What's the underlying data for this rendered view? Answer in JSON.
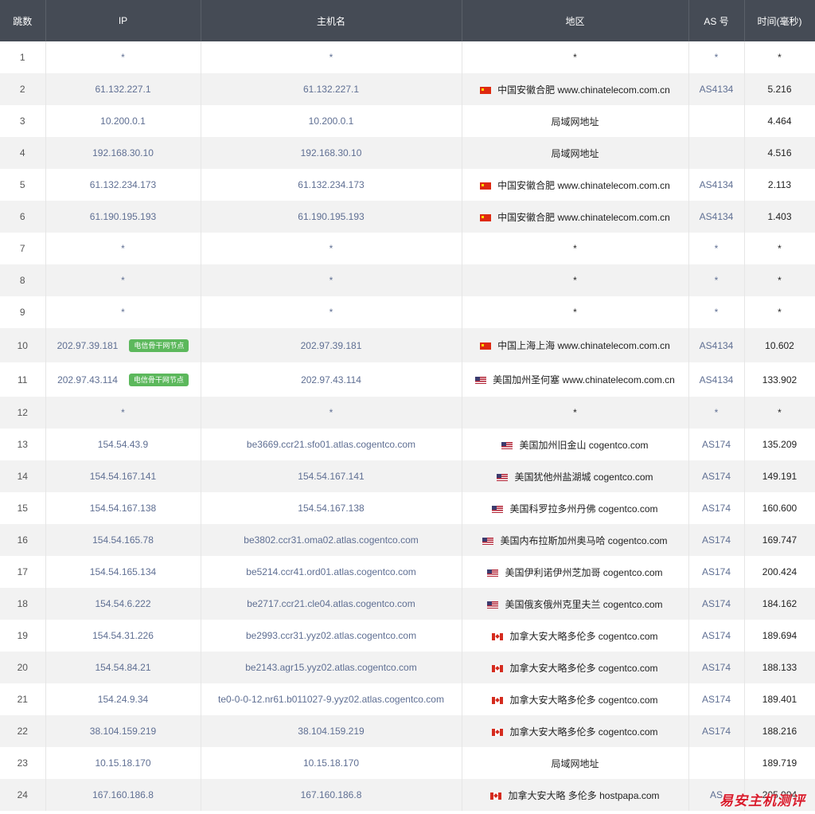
{
  "headers": {
    "hop": "跳数",
    "ip": "IP",
    "host": "主机名",
    "region": "地区",
    "as": "AS 号",
    "time": "时间(毫秒)"
  },
  "colors": {
    "header_bg": "#454b55",
    "badge_bg": "#5cb85c",
    "link_text": "#5f6f93",
    "stripe": "#f2f2f2",
    "watermark": "#d91c2c"
  },
  "rows": [
    {
      "hop": "1",
      "ip": "*",
      "host": "*",
      "flag": "",
      "region": "*",
      "as": "*",
      "time": "*"
    },
    {
      "hop": "2",
      "ip": "61.132.227.1",
      "host": "61.132.227.1",
      "flag": "cn-flag-icon",
      "region": "中国安徽合肥 www.chinatelecom.com.cn",
      "as": "AS4134",
      "time": "5.216"
    },
    {
      "hop": "3",
      "ip": "10.200.0.1",
      "host": "10.200.0.1",
      "flag": "",
      "region": "局域网地址",
      "as": "",
      "time": "4.464"
    },
    {
      "hop": "4",
      "ip": "192.168.30.10",
      "host": "192.168.30.10",
      "flag": "",
      "region": "局域网地址",
      "as": "",
      "time": "4.516"
    },
    {
      "hop": "5",
      "ip": "61.132.234.173",
      "host": "61.132.234.173",
      "flag": "cn-flag-icon",
      "region": "中国安徽合肥 www.chinatelecom.com.cn",
      "as": "AS4134",
      "time": "2.113"
    },
    {
      "hop": "6",
      "ip": "61.190.195.193",
      "host": "61.190.195.193",
      "flag": "cn-flag-icon",
      "region": "中国安徽合肥 www.chinatelecom.com.cn",
      "as": "AS4134",
      "time": "1.403"
    },
    {
      "hop": "7",
      "ip": "*",
      "host": "*",
      "flag": "",
      "region": "*",
      "as": "*",
      "time": "*"
    },
    {
      "hop": "8",
      "ip": "*",
      "host": "*",
      "flag": "",
      "region": "*",
      "as": "*",
      "time": "*"
    },
    {
      "hop": "9",
      "ip": "*",
      "host": "*",
      "flag": "",
      "region": "*",
      "as": "*",
      "time": "*"
    },
    {
      "hop": "10",
      "ip": "202.97.39.181",
      "badge": "电信骨干网节点",
      "host": "202.97.39.181",
      "flag": "cn-flag-icon",
      "region": "中国上海上海 www.chinatelecom.com.cn",
      "as": "AS4134",
      "time": "10.602"
    },
    {
      "hop": "11",
      "ip": "202.97.43.114",
      "badge": "电信骨干网节点",
      "host": "202.97.43.114",
      "flag": "us-flag-icon",
      "region": "美国加州圣何塞 www.chinatelecom.com.cn",
      "as": "AS4134",
      "time": "133.902"
    },
    {
      "hop": "12",
      "ip": "*",
      "host": "*",
      "flag": "",
      "region": "*",
      "as": "*",
      "time": "*"
    },
    {
      "hop": "13",
      "ip": "154.54.43.9",
      "host": "be3669.ccr21.sfo01.atlas.cogentco.com",
      "flag": "us-flag-icon",
      "region": "美国加州旧金山 cogentco.com",
      "as": "AS174",
      "time": "135.209"
    },
    {
      "hop": "14",
      "ip": "154.54.167.141",
      "host": "154.54.167.141",
      "flag": "us-flag-icon",
      "region": "美国犹他州盐湖城 cogentco.com",
      "as": "AS174",
      "time": "149.191"
    },
    {
      "hop": "15",
      "ip": "154.54.167.138",
      "host": "154.54.167.138",
      "flag": "us-flag-icon",
      "region": "美国科罗拉多州丹佛 cogentco.com",
      "as": "AS174",
      "time": "160.600"
    },
    {
      "hop": "16",
      "ip": "154.54.165.78",
      "host": "be3802.ccr31.oma02.atlas.cogentco.com",
      "flag": "us-flag-icon",
      "region": "美国内布拉斯加州奥马哈 cogentco.com",
      "as": "AS174",
      "time": "169.747"
    },
    {
      "hop": "17",
      "ip": "154.54.165.134",
      "host": "be5214.ccr41.ord01.atlas.cogentco.com",
      "flag": "us-flag-icon",
      "region": "美国伊利诺伊州芝加哥 cogentco.com",
      "as": "AS174",
      "time": "200.424"
    },
    {
      "hop": "18",
      "ip": "154.54.6.222",
      "host": "be2717.ccr21.cle04.atlas.cogentco.com",
      "flag": "us-flag-icon",
      "region": "美国俄亥俄州克里夫兰 cogentco.com",
      "as": "AS174",
      "time": "184.162"
    },
    {
      "hop": "19",
      "ip": "154.54.31.226",
      "host": "be2993.ccr31.yyz02.atlas.cogentco.com",
      "flag": "ca-flag-icon",
      "region": "加拿大安大略多伦多 cogentco.com",
      "as": "AS174",
      "time": "189.694"
    },
    {
      "hop": "20",
      "ip": "154.54.84.21",
      "host": "be2143.agr15.yyz02.atlas.cogentco.com",
      "flag": "ca-flag-icon",
      "region": "加拿大安大略多伦多 cogentco.com",
      "as": "AS174",
      "time": "188.133"
    },
    {
      "hop": "21",
      "ip": "154.24.9.34",
      "host": "te0-0-0-12.nr61.b011027-9.yyz02.atlas.cogentco.com",
      "flag": "ca-flag-icon",
      "region": "加拿大安大略多伦多 cogentco.com",
      "as": "AS174",
      "time": "189.401"
    },
    {
      "hop": "22",
      "ip": "38.104.159.219",
      "host": "38.104.159.219",
      "flag": "ca-flag-icon",
      "region": "加拿大安大略多伦多 cogentco.com",
      "as": "AS174",
      "time": "188.216"
    },
    {
      "hop": "23",
      "ip": "10.15.18.170",
      "host": "10.15.18.170",
      "flag": "",
      "region": "局域网地址",
      "as": "",
      "time": "189.719"
    },
    {
      "hop": "24",
      "ip": "167.160.186.8",
      "host": "167.160.186.8",
      "flag": "ca-flag-icon",
      "region": "加拿大安大略 多伦多 hostpapa.com",
      "as": "AS",
      "time": "205.994"
    }
  ],
  "watermark": "易安主机测评"
}
